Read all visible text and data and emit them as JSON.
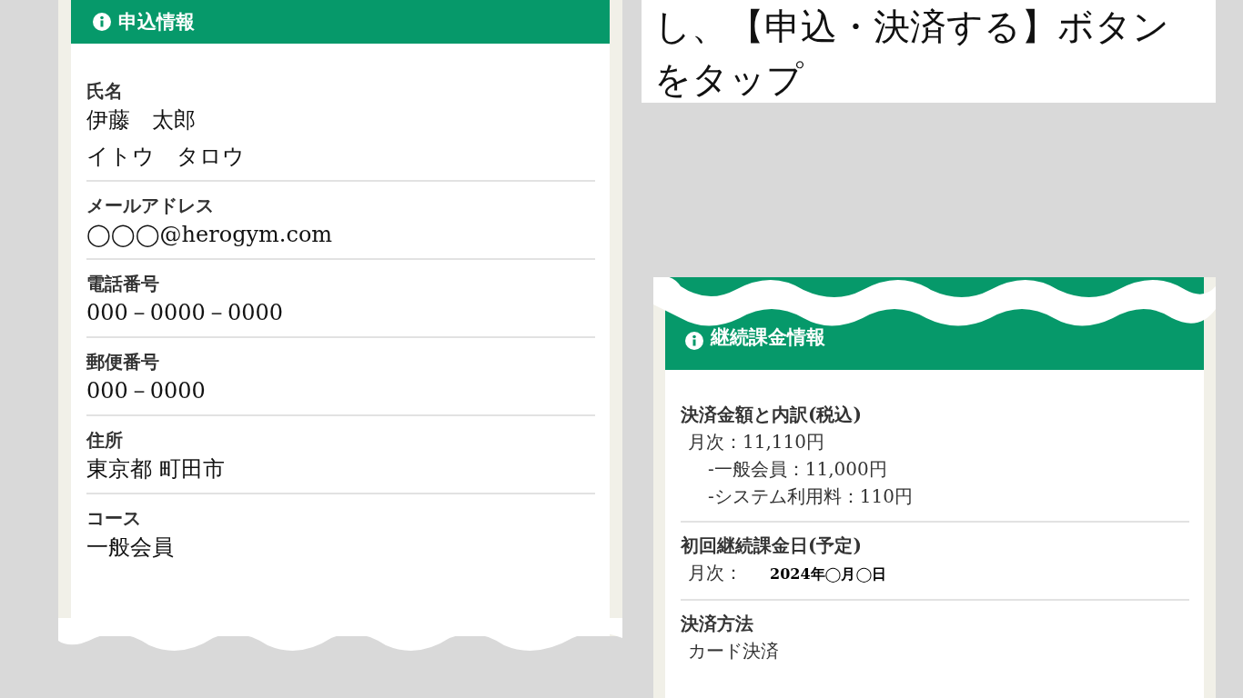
{
  "application_panel": {
    "title": "申込情報",
    "fields": [
      {
        "label": "氏名",
        "values": [
          "伊藤　太郎",
          "イトウ　タロウ"
        ]
      },
      {
        "label": "メールアドレス",
        "values": [
          "◯◯◯@herogym.com"
        ]
      },
      {
        "label": "電話番号",
        "values": [
          "000－0000－0000"
        ]
      },
      {
        "label": "郵便番号",
        "values": [
          "000－0000"
        ]
      },
      {
        "label": "住所",
        "values": [
          "東京都 町田市"
        ]
      },
      {
        "label": "コース",
        "values": [
          "一般会員"
        ]
      }
    ]
  },
  "instruction": {
    "text": "し、【申込・決済する】ボタンをタップ"
  },
  "billing_panel": {
    "title": "継続課金情報",
    "fields": [
      {
        "label": "決済金額と内訳(税込)",
        "lines": [
          {
            "kind": "main",
            "text": "月次：11,110円"
          },
          {
            "kind": "sub",
            "text": "-一般会員：11,000円"
          },
          {
            "kind": "sub",
            "text": "-システム利用料：110円"
          }
        ]
      },
      {
        "label": "初回継続課金日(予定)",
        "lines": [
          {
            "kind": "date",
            "text": "月次：",
            "date": "2024年◯月◯日"
          }
        ]
      },
      {
        "label": "決済方法",
        "lines": [
          {
            "kind": "main",
            "text": "カード決済"
          }
        ]
      }
    ]
  }
}
